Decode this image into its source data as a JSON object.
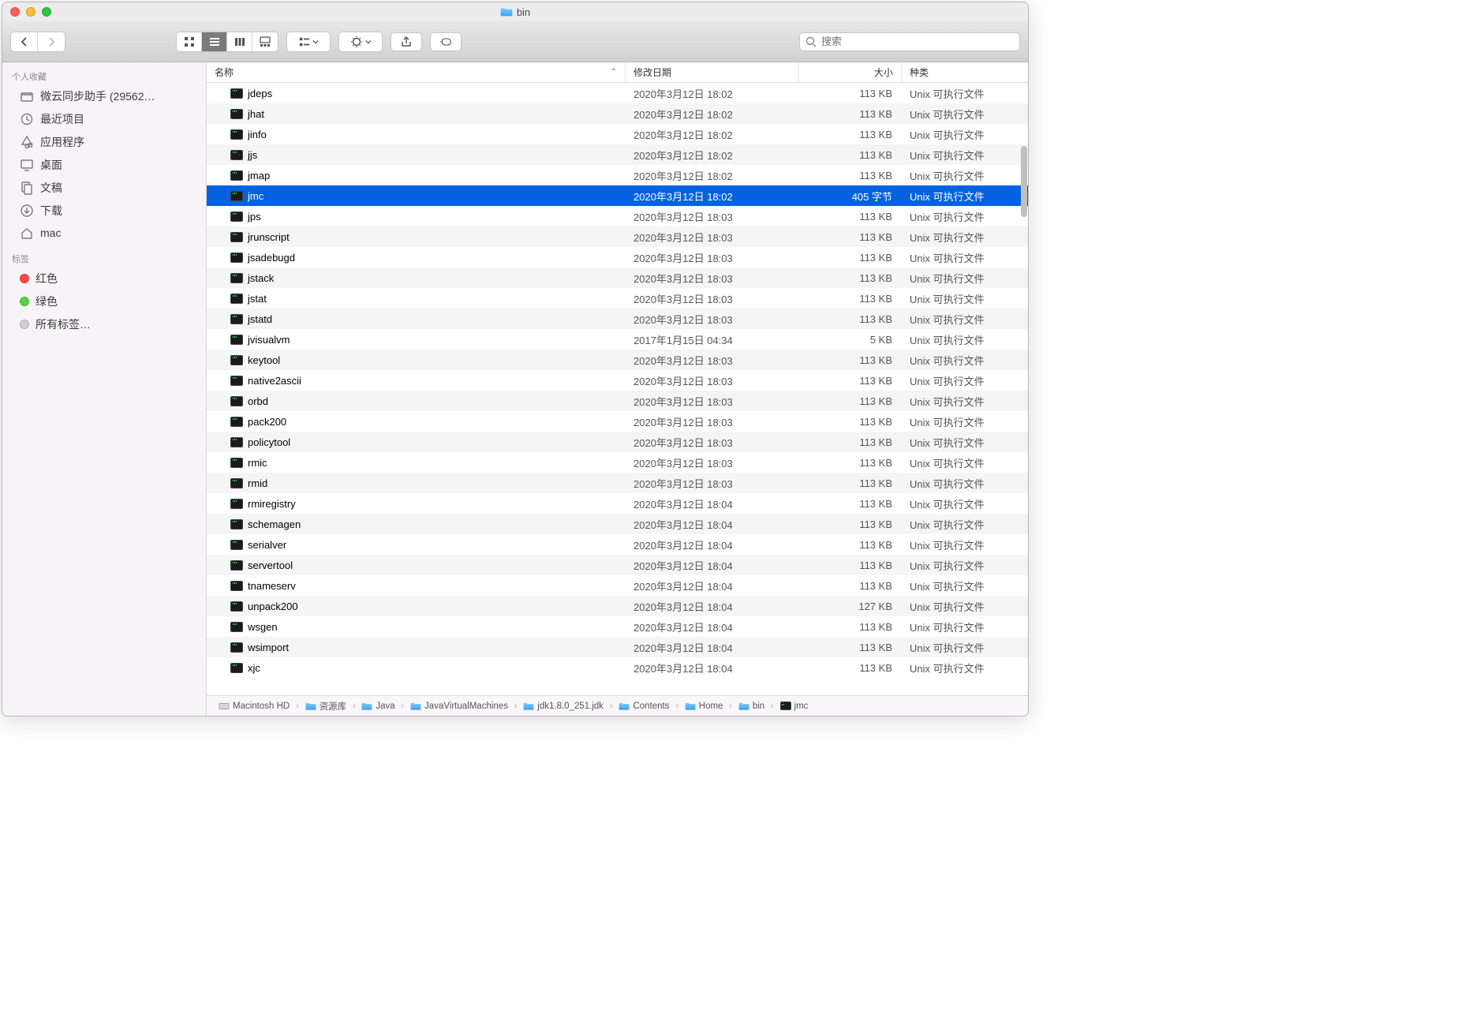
{
  "window": {
    "title": "bin"
  },
  "search": {
    "placeholder": "搜索"
  },
  "sidebar": {
    "favorites_label": "个人收藏",
    "tags_label": "标签",
    "favorites": [
      {
        "label": "微云同步助手 (29562…",
        "icon": "folder"
      },
      {
        "label": "最近项目",
        "icon": "clock"
      },
      {
        "label": "应用程序",
        "icon": "apps"
      },
      {
        "label": "桌面",
        "icon": "desktop"
      },
      {
        "label": "文稿",
        "icon": "docs"
      },
      {
        "label": "下载",
        "icon": "download"
      },
      {
        "label": "mac",
        "icon": "home"
      }
    ],
    "tags": [
      {
        "label": "红色",
        "color": "#ff4b42"
      },
      {
        "label": "绿色",
        "color": "#55d244"
      },
      {
        "label": "所有标签…",
        "color": "#cfcfcf"
      }
    ]
  },
  "columns": {
    "name": "名称",
    "date": "修改日期",
    "size": "大小",
    "kind": "种类"
  },
  "kind_label": "Unix 可执行文件",
  "files": [
    {
      "name": "jdeps",
      "date": "2020年3月12日 18:02",
      "size": "113 KB"
    },
    {
      "name": "jhat",
      "date": "2020年3月12日 18:02",
      "size": "113 KB"
    },
    {
      "name": "jinfo",
      "date": "2020年3月12日 18:02",
      "size": "113 KB"
    },
    {
      "name": "jjs",
      "date": "2020年3月12日 18:02",
      "size": "113 KB"
    },
    {
      "name": "jmap",
      "date": "2020年3月12日 18:02",
      "size": "113 KB"
    },
    {
      "name": "jmc",
      "date": "2020年3月12日 18:02",
      "size": "405 字节",
      "selected": true
    },
    {
      "name": "jps",
      "date": "2020年3月12日 18:03",
      "size": "113 KB"
    },
    {
      "name": "jrunscript",
      "date": "2020年3月12日 18:03",
      "size": "113 KB"
    },
    {
      "name": "jsadebugd",
      "date": "2020年3月12日 18:03",
      "size": "113 KB"
    },
    {
      "name": "jstack",
      "date": "2020年3月12日 18:03",
      "size": "113 KB"
    },
    {
      "name": "jstat",
      "date": "2020年3月12日 18:03",
      "size": "113 KB"
    },
    {
      "name": "jstatd",
      "date": "2020年3月12日 18:03",
      "size": "113 KB"
    },
    {
      "name": "jvisualvm",
      "date": "2017年1月15日 04:34",
      "size": "5 KB"
    },
    {
      "name": "keytool",
      "date": "2020年3月12日 18:03",
      "size": "113 KB"
    },
    {
      "name": "native2ascii",
      "date": "2020年3月12日 18:03",
      "size": "113 KB"
    },
    {
      "name": "orbd",
      "date": "2020年3月12日 18:03",
      "size": "113 KB"
    },
    {
      "name": "pack200",
      "date": "2020年3月12日 18:03",
      "size": "113 KB"
    },
    {
      "name": "policytool",
      "date": "2020年3月12日 18:03",
      "size": "113 KB"
    },
    {
      "name": "rmic",
      "date": "2020年3月12日 18:03",
      "size": "113 KB"
    },
    {
      "name": "rmid",
      "date": "2020年3月12日 18:03",
      "size": "113 KB"
    },
    {
      "name": "rmiregistry",
      "date": "2020年3月12日 18:04",
      "size": "113 KB"
    },
    {
      "name": "schemagen",
      "date": "2020年3月12日 18:04",
      "size": "113 KB"
    },
    {
      "name": "serialver",
      "date": "2020年3月12日 18:04",
      "size": "113 KB"
    },
    {
      "name": "servertool",
      "date": "2020年3月12日 18:04",
      "size": "113 KB"
    },
    {
      "name": "tnameserv",
      "date": "2020年3月12日 18:04",
      "size": "113 KB"
    },
    {
      "name": "unpack200",
      "date": "2020年3月12日 18:04",
      "size": "127 KB"
    },
    {
      "name": "wsgen",
      "date": "2020年3月12日 18:04",
      "size": "113 KB"
    },
    {
      "name": "wsimport",
      "date": "2020年3月12日 18:04",
      "size": "113 KB"
    },
    {
      "name": "xjc",
      "date": "2020年3月12日 18:04",
      "size": "113 KB"
    }
  ],
  "path": [
    {
      "label": "Macintosh HD",
      "type": "disk"
    },
    {
      "label": "资源库",
      "type": "folder"
    },
    {
      "label": "Java",
      "type": "folder"
    },
    {
      "label": "JavaVirtualMachines",
      "type": "folder"
    },
    {
      "label": "jdk1.8.0_251.jdk",
      "type": "folder"
    },
    {
      "label": "Contents",
      "type": "folder"
    },
    {
      "label": "Home",
      "type": "folder"
    },
    {
      "label": "bin",
      "type": "folder"
    },
    {
      "label": "jmc",
      "type": "exec"
    }
  ]
}
